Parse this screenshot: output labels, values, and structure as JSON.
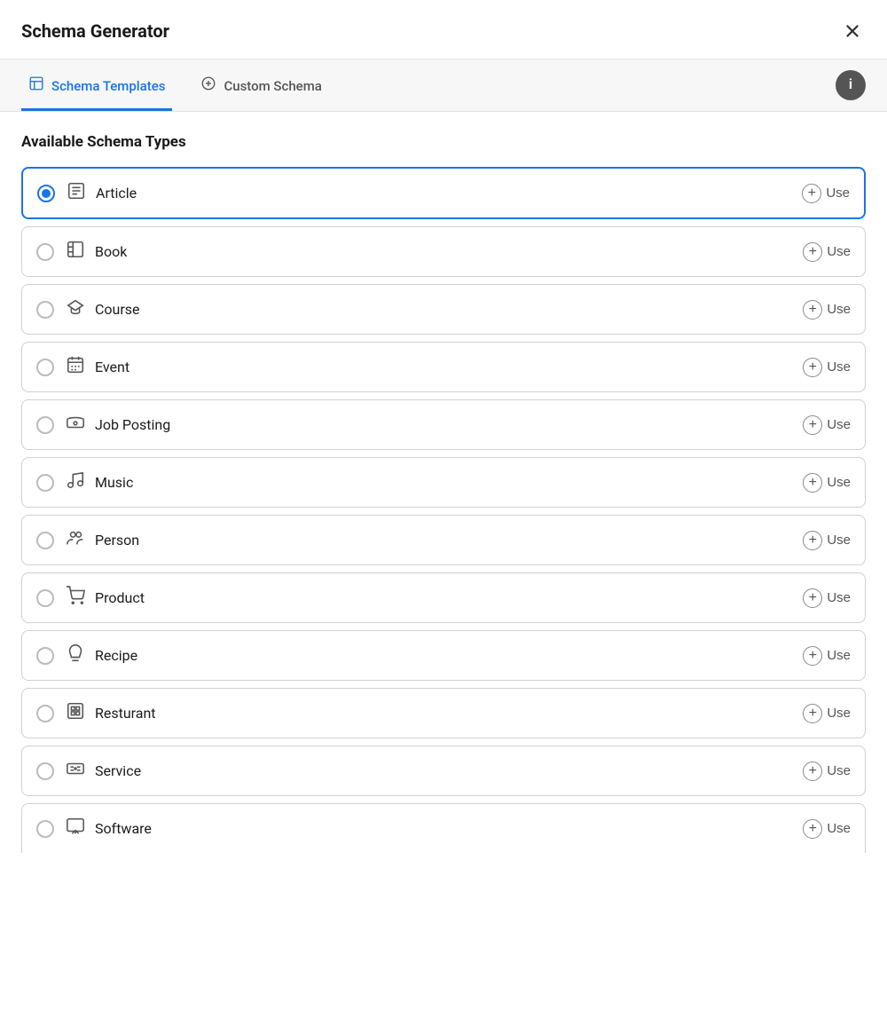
{
  "header": {
    "title": "Schema Generator",
    "close_label": "×"
  },
  "tabs": [
    {
      "id": "schema-templates",
      "label": "Schema Templates",
      "icon": "template-icon",
      "active": true
    },
    {
      "id": "custom-schema",
      "label": "Custom Schema",
      "icon": "plus-circle-icon",
      "active": false
    }
  ],
  "info_button_label": "i",
  "section": {
    "title": "Available Schema Types"
  },
  "schema_items": [
    {
      "id": "article",
      "label": "Article",
      "icon": "article-icon",
      "selected": true
    },
    {
      "id": "book",
      "label": "Book",
      "icon": "book-icon",
      "selected": false
    },
    {
      "id": "course",
      "label": "Course",
      "icon": "course-icon",
      "selected": false
    },
    {
      "id": "event",
      "label": "Event",
      "icon": "event-icon",
      "selected": false
    },
    {
      "id": "job-posting",
      "label": "Job Posting",
      "icon": "job-icon",
      "selected": false
    },
    {
      "id": "music",
      "label": "Music",
      "icon": "music-icon",
      "selected": false
    },
    {
      "id": "person",
      "label": "Person",
      "icon": "person-icon",
      "selected": false
    },
    {
      "id": "product",
      "label": "Product",
      "icon": "product-icon",
      "selected": false
    },
    {
      "id": "recipe",
      "label": "Recipe",
      "icon": "recipe-icon",
      "selected": false
    },
    {
      "id": "resturant",
      "label": "Resturant",
      "icon": "restaurant-icon",
      "selected": false
    },
    {
      "id": "service",
      "label": "Service",
      "icon": "service-icon",
      "selected": false
    },
    {
      "id": "software",
      "label": "Software",
      "icon": "software-icon",
      "selected": false
    }
  ],
  "use_label": "Use"
}
